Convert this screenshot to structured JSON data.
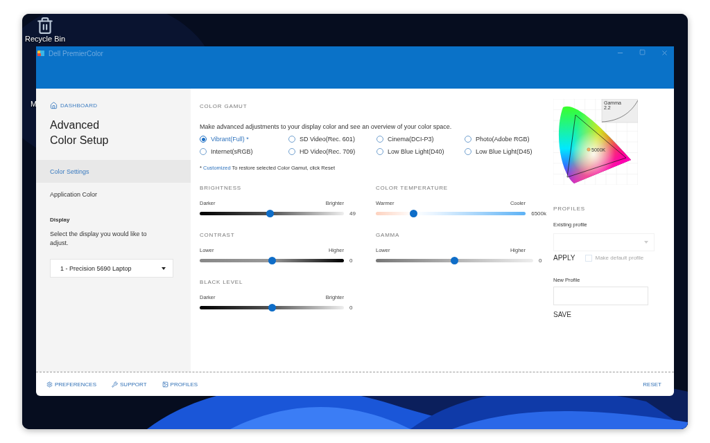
{
  "desktop": {
    "icons": [
      {
        "label": "Recycle Bin",
        "kind": "bin"
      },
      {
        "label": "M",
        "kind": "partial"
      }
    ]
  },
  "window": {
    "title": "Dell PremierColor"
  },
  "sidebar": {
    "dashboard_link": "DASHBOARD",
    "heading": "Advanced Color Setup",
    "items": [
      {
        "label": "Color Settings",
        "selected": true
      },
      {
        "label": "Application Color",
        "selected": false
      }
    ],
    "display": {
      "title": "Display",
      "description": "Select the display you would like to adjust.",
      "value": "1 - Precision 5690 Laptop"
    }
  },
  "color_gamut": {
    "title": "COLOR GAMUT",
    "description": "Make advanced adjustments to your display color and see an overview of your color space.",
    "options": [
      {
        "label": "Vibrant(Full) *",
        "selected": true
      },
      {
        "label": "SD Video(Rec. 601)",
        "selected": false
      },
      {
        "label": "Cinema(DCI-P3)",
        "selected": false
      },
      {
        "label": "Photo(Adobe RGB)",
        "selected": false
      },
      {
        "label": "Internet(sRGB)",
        "selected": false
      },
      {
        "label": "HD Video(Rec. 709)",
        "selected": false
      },
      {
        "label": "Low Blue Light(D40)",
        "selected": false
      },
      {
        "label": "Low Blue Light(D45)",
        "selected": false
      }
    ],
    "note_mark": "*",
    "note_link": "Customized",
    "note_text": "To restore selected Color Gamut, click Reset"
  },
  "sliders": [
    {
      "title": "BRIGHTNESS",
      "kind": "dark",
      "min_label": "Darker",
      "max_label": "Brighter",
      "level": 0.49,
      "reading": "49"
    },
    {
      "title": "COLOR TEMPERATURE",
      "kind": "temperature",
      "min_label": "Warmer",
      "max_label": "Cooler",
      "level": 0.25,
      "reading": "6500k"
    },
    {
      "title": "CONTRAST",
      "kind": "contrast",
      "min_label": "Lower",
      "max_label": "Higher",
      "level": 0.5,
      "reading": "0"
    },
    {
      "title": "GAMMA",
      "kind": "gamma",
      "min_label": "Lower",
      "max_label": "Higher",
      "level": 0.5,
      "reading": "0"
    },
    {
      "title": "BLACK LEVEL",
      "kind": "dark",
      "min_label": "Darker",
      "max_label": "Brighter",
      "level": 0.5,
      "reading": "0"
    }
  ],
  "gamut_chart": {
    "gamma_label": "Gamma",
    "gamma_value": "2.2",
    "white_point": "5000K"
  },
  "profiles": {
    "title": "PROFILES",
    "existing_label": "Existing profile",
    "apply": "APPLY",
    "default_checkbox": {
      "label": "Make default profile",
      "checked": false,
      "disabled": true
    },
    "new_label": "New Profile",
    "save": "SAVE"
  },
  "footer": {
    "links": [
      {
        "label": "PREFERENCES",
        "kind": "preferences"
      },
      {
        "label": "SUPPORT",
        "kind": "support"
      },
      {
        "label": "PROFILES",
        "kind": "profiles"
      }
    ],
    "reset": "RESET"
  }
}
